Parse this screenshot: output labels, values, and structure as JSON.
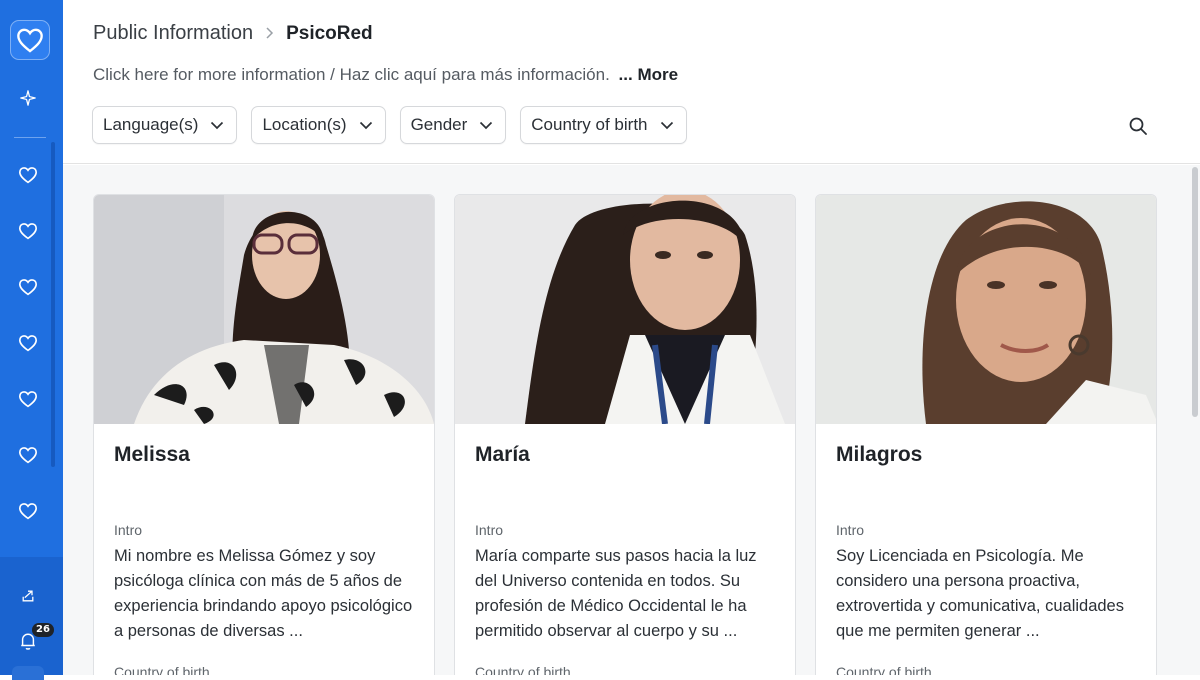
{
  "sidebar": {
    "logo_icon": "heart-icon",
    "notification_count": "26",
    "accent": "#1f6fe0"
  },
  "header": {
    "breadcrumb": {
      "parent": "Public Information",
      "current": "PsicoRed"
    },
    "info_text": "Click here for more information / Haz clic aquí para más información.",
    "more_label": "... More"
  },
  "filters": [
    {
      "label": "Language(s)"
    },
    {
      "label": "Location(s)"
    },
    {
      "label": "Gender"
    },
    {
      "label": "Country of birth"
    }
  ],
  "cards": [
    {
      "name": "Melissa",
      "intro_label": "Intro",
      "intro": "Mi nombre es Melissa Gómez y soy psicóloga clínica con más de 5 años de experiencia brindando apoyo psicológico a personas de diversas ...",
      "country_label": "Country of birth"
    },
    {
      "name": "María",
      "intro_label": "Intro",
      "intro": "María comparte sus pasos hacia la luz del Universo contenida en todos. Su profesión de Médico Occidental le ha permitido observar al cuerpo y su ...",
      "country_label": "Country of birth"
    },
    {
      "name": "Milagros",
      "intro_label": "Intro",
      "intro": "Soy Licenciada en Psicología. Me considero una persona proactiva, extrovertida y comunicativa, cualidades que me permiten generar ...",
      "country_label": "Country of birth"
    }
  ]
}
